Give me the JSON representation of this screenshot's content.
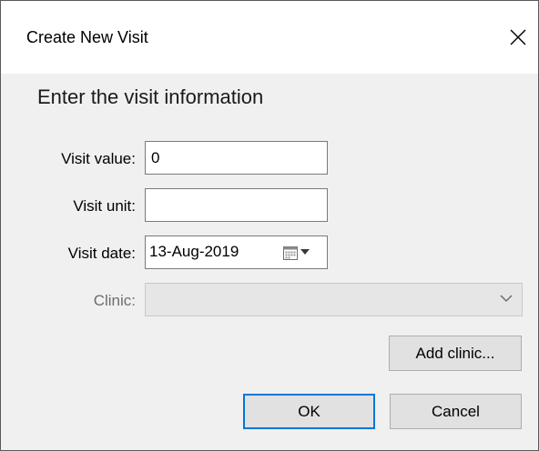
{
  "window": {
    "title": "Create New Visit",
    "close_icon": "close-icon"
  },
  "form": {
    "heading": "Enter the visit information",
    "visit_value": {
      "label": "Visit value:",
      "value": "0"
    },
    "visit_unit": {
      "label": "Visit unit:",
      "value": ""
    },
    "visit_date": {
      "label": "Visit date:",
      "value": "13-Aug-2019"
    },
    "clinic": {
      "label": "Clinic:",
      "value": "",
      "enabled": false
    }
  },
  "buttons": {
    "add_clinic": "Add clinic...",
    "ok": "OK",
    "cancel": "Cancel"
  },
  "colors": {
    "dialog_background": "#f0f0f0",
    "title_background": "#ffffff",
    "default_button_border": "#0078d7"
  }
}
